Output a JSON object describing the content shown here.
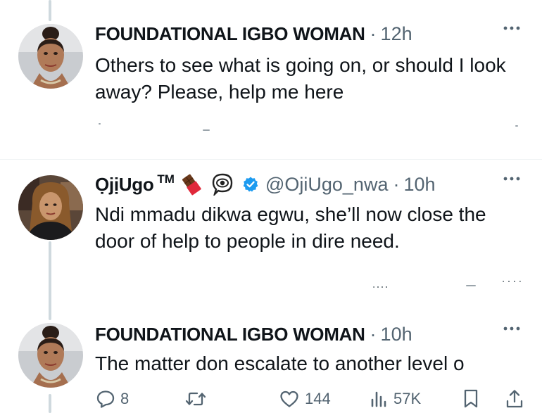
{
  "thread": [
    {
      "name": "FOUNDATIONAL IGBO WOMAN",
      "separator": "·",
      "time": "12h",
      "text": "Others to see what is going on, or should I look away? Please, help me here"
    },
    {
      "name": "ỌjịUgo",
      "tm": "TM",
      "handle": "@OjiUgo_nwa",
      "separator": "·",
      "time": "10h",
      "verified": true,
      "text": "Ndi mmadu dikwa egwu, she’ll now close the door of help to people in dire need."
    },
    {
      "name": "FOUNDATIONAL IGBO WOMAN",
      "separator": "·",
      "time": "10h",
      "text": "The matter don escalate to another level o",
      "actions": {
        "replies": "8",
        "retweets": "",
        "likes": "144",
        "views": "57K"
      }
    }
  ],
  "icons": {
    "more": "more-horizontal-icon",
    "verified": "verified-badge-icon",
    "emoji1": "chocolate-bar-emoji",
    "emoji2": "eye-in-speech-bubble-emoji",
    "reply": "reply-icon",
    "retweet": "retweet-icon",
    "like": "heart-icon",
    "views": "views-chart-icon",
    "bookmark": "bookmark-icon",
    "share": "share-icon"
  },
  "colors": {
    "text": "#0f1419",
    "secondary": "#536471",
    "verified": "#1d9bf0",
    "thread_line": "#cfd9de",
    "divider": "#eff3f4"
  }
}
